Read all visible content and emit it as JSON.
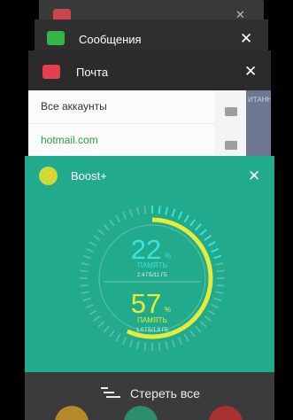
{
  "cards": [
    {
      "title": "",
      "close": "✕"
    },
    {
      "title": "Сообщения",
      "close": "✕"
    },
    {
      "title": "Почта",
      "close": "✕"
    },
    {
      "title": "Boost+",
      "close": "✕"
    }
  ],
  "mail": {
    "rows": [
      "Все аккаунты",
      "hotmail.com"
    ],
    "side_text": "ИТАННЫЕ"
  },
  "boost": {
    "memory_pct": "22",
    "memory_label": "ПАМЯТЬ",
    "memory_detail": "2,4 ГБ/11 ГБ",
    "memory_progress": 0.22,
    "storage_pct": "57",
    "storage_label": "ПАМЯТЬ",
    "storage_detail": "1,0 ГБ/1,8 ГБ",
    "storage_progress": 0.57,
    "percent_sign": "%",
    "colors": {
      "background": "#22aa8d",
      "memory": "#3fe0de",
      "storage": "#e6ec3c"
    }
  },
  "clear_all_label": "Стереть все",
  "icons": {
    "messages": "chat-bubble-icon",
    "mail": "envelope-icon",
    "boost": "lightning-icon",
    "clear": "clear-list-icon"
  }
}
